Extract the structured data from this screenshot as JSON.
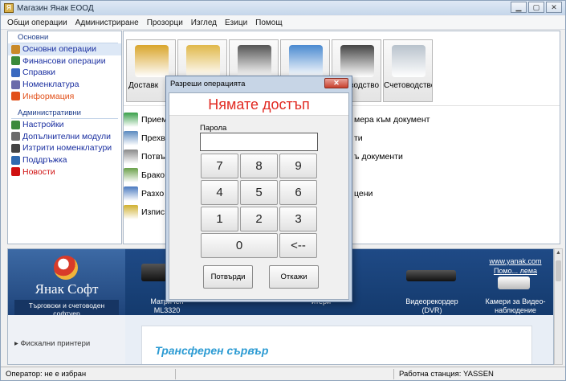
{
  "window": {
    "title": "Магазин Янак ЕООД",
    "controls": [
      "▁",
      "▢",
      "✕"
    ]
  },
  "menu": [
    "Общи операции",
    "Администриране",
    "Прозорци",
    "Изглед",
    "Езици",
    "Помощ"
  ],
  "sidebar": {
    "group1": "Основни",
    "items1": [
      {
        "label": "Основни операции",
        "icon": "folder-icon",
        "color": "#c98a2a",
        "selected": true
      },
      {
        "label": "Финансови операции",
        "icon": "finance-icon",
        "color": "#3a8a3a"
      },
      {
        "label": "Справки",
        "icon": "reports-icon",
        "color": "#3a6ac0"
      },
      {
        "label": "Номенклатура",
        "icon": "nomenclature-icon",
        "color": "#6a6aaa"
      },
      {
        "label": "Информация",
        "icon": "info-icon",
        "color": "#e2501a",
        "style": "warn"
      }
    ],
    "group2": "Административни",
    "items2": [
      {
        "label": "Настройки",
        "icon": "settings-icon",
        "color": "#3c8a3c"
      },
      {
        "label": "Допълнителни модули",
        "icon": "modules-icon",
        "color": "#6a6a6a"
      },
      {
        "label": "Изтрити номенклатури",
        "icon": "deleted-icon",
        "color": "#444"
      },
      {
        "label": "Поддръжка",
        "icon": "support-icon",
        "color": "#2f6ab0"
      },
      {
        "label": "Новости",
        "icon": "news-icon",
        "color": "#d01010",
        "style": "red"
      }
    ]
  },
  "tiles": [
    {
      "label": "Доставк",
      "icon": "truck-icon",
      "color": "#d9a52a",
      "clip": "left"
    },
    {
      "label": "",
      "icon": "cash-register-icon",
      "color": "#e0b84a"
    },
    {
      "label": "",
      "icon": "barcode-icon",
      "color": "#555555"
    },
    {
      "label": "",
      "icon": "building-icon",
      "color": "#4a8ad0"
    },
    {
      "label": "водство",
      "icon": "gears-icon",
      "color": "#444444",
      "clip": "right"
    },
    {
      "label": "Счетоводство",
      "icon": "calculator-icon",
      "color": "#b8c2cc"
    }
  ],
  "operations": [
    {
      "label": "Прием",
      "right": "мера към документ",
      "icon": "receive-icon",
      "color": "#3aa04a"
    },
    {
      "label": "Прехв",
      "right": "ти",
      "icon": "transfer-icon",
      "color": "#5a8ac0"
    },
    {
      "label": "Потвъ",
      "right": "ъ документи",
      "icon": "confirm-icon",
      "color": "#8a8a8a"
    },
    {
      "label": "Брако",
      "right": "",
      "icon": "scrap-icon",
      "color": "#6aa04a"
    },
    {
      "label": "Разхо",
      "right": "цени",
      "icon": "expense-icon",
      "color": "#4a7ac0"
    },
    {
      "label": "Изпис",
      "right": "",
      "icon": "writeoff-icon",
      "color": "#d0b030"
    }
  ],
  "banner": {
    "brand": "Янак Софт",
    "slogan": "Търговски и счетоводен софтуер",
    "products": [
      {
        "caption1": "Матричен",
        "caption2": "ML3320"
      },
      {
        "caption1": "итери",
        "caption2": ""
      },
      {
        "caption1": "Видеорекордер",
        "caption2": "(DVR)"
      },
      {
        "caption1": "Камери за Видео-",
        "caption2": "наблюдение",
        "link": "www.yanak.com",
        "link2": "Помо... лема"
      }
    ],
    "side_link": "Фискални принтери",
    "promo": "Трансферен сървър"
  },
  "status": {
    "operator_label": "Оператор:",
    "operator_value": "не е избран",
    "station_label": "Работна станция:",
    "station_value": "YASSEN"
  },
  "dialog": {
    "title": "Разреши операцията",
    "close": "✕",
    "message": "Нямате достъп",
    "password_label": "Парола",
    "password_value": "",
    "keys": [
      {
        "label": "7"
      },
      {
        "label": "8"
      },
      {
        "label": "9"
      },
      {
        "label": "4"
      },
      {
        "label": "5"
      },
      {
        "label": "6"
      },
      {
        "label": "1"
      },
      {
        "label": "2"
      },
      {
        "label": "3"
      },
      {
        "label": "0"
      },
      {
        "label": "<--"
      }
    ],
    "confirm": "Потвърди",
    "cancel": "Откажи"
  }
}
